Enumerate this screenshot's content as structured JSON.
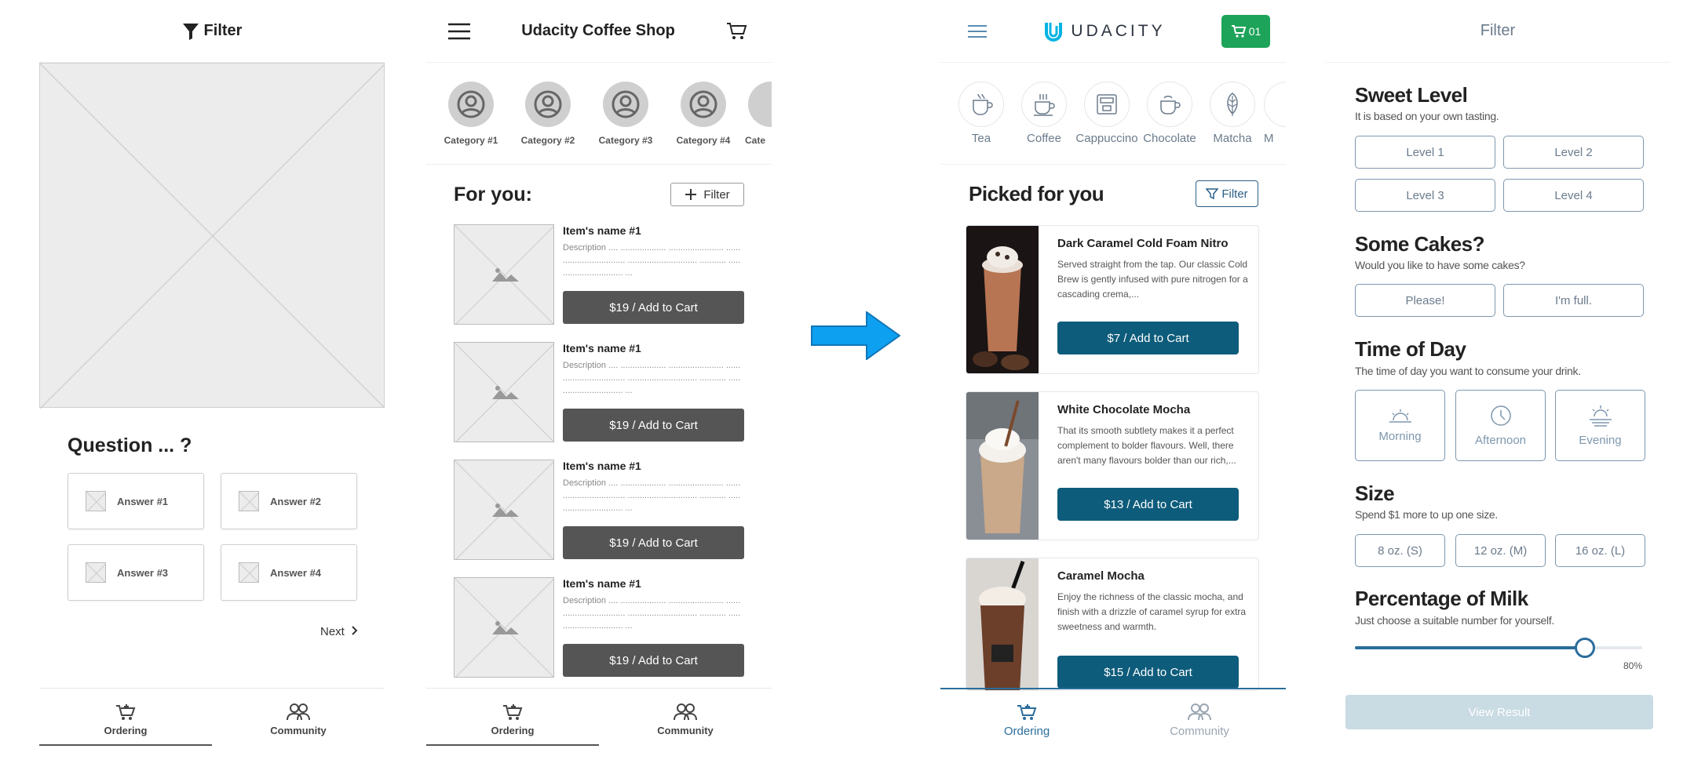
{
  "wireframe": {
    "header": {
      "title": "Filter"
    },
    "question": "Question ... ?",
    "answers": [
      "Answer #1",
      "Answer #2",
      "Answer #3",
      "Answer #4"
    ],
    "next_label": "Next",
    "nav": [
      {
        "label": "Ordering"
      },
      {
        "label": "Community"
      }
    ]
  },
  "wireframe_shop": {
    "header": {
      "title": "Udacity Coffee Shop"
    },
    "categories": [
      "Category #1",
      "Category #2",
      "Category #3",
      "Category #4",
      "Cate"
    ],
    "for_you": "For you:",
    "filter_label": "Filter",
    "items": [
      {
        "name": "Item's name #1",
        "desc": "Description .... ................... ....................... ...... .......................... ............................. ........... ..... ......................... ...",
        "cart": "$19 / Add to Cart"
      },
      {
        "name": "Item's name #1",
        "desc": "Description .... ................... ....................... ...... .......................... ............................. ........... ..... ......................... ...",
        "cart": "$19 / Add to Cart"
      },
      {
        "name": "Item's name #1",
        "desc": "Description .... ................... ....................... ...... .......................... ............................. ........... ..... ......................... ...",
        "cart": "$19 / Add to Cart"
      },
      {
        "name": "Item's name #1",
        "desc": "Description .... ................... ....................... ...... .......................... ............................. ........... ..... ......................... ...",
        "cart": "$19 / Add to Cart"
      }
    ],
    "nav": [
      {
        "label": "Ordering"
      },
      {
        "label": "Community"
      }
    ]
  },
  "app": {
    "logo": "UDACITY",
    "cart_count": "01",
    "categories": [
      "Tea",
      "Coffee",
      "Cappuccino",
      "Chocolate",
      "Matcha",
      "M"
    ],
    "picked": "Picked for you",
    "filter_label": "Filter",
    "products": [
      {
        "name": "Dark Caramel Cold Foam Nitro",
        "desc": "Served straight from the tap. Our classic Cold Brew is gently infused with pure nitrogen for a cascading crema,...",
        "cart": "$7 / Add to Cart"
      },
      {
        "name": "White Chocolate Mocha",
        "desc": "That its smooth subtlety makes it a perfect complement to bolder flavours. Well, there aren't many flavours bolder than our rich,...",
        "cart": "$13 / Add to Cart"
      },
      {
        "name": "Caramel Mocha",
        "desc": "Enjoy the richness of the classic mocha, and finish with a drizzle of caramel syrup for extra sweetness and warmth.",
        "cart": "$15 / Add to Cart"
      }
    ],
    "nav": [
      {
        "label": "Ordering"
      },
      {
        "label": "Community"
      }
    ],
    "accent": "#0e5c7b",
    "badge_color": "#1ea35a"
  },
  "filter": {
    "title": "Filter",
    "sweet": {
      "title": "Sweet Level",
      "desc": "It is based on your own tasting.",
      "options": [
        "Level 1",
        "Level 2",
        "Level 3",
        "Level 4"
      ]
    },
    "cakes": {
      "title": "Some Cakes?",
      "desc": "Would you like to have some cakes?",
      "options": [
        "Please!",
        "I'm full."
      ]
    },
    "time": {
      "title": "Time of Day",
      "desc": "The time of day you want to consume your drink.",
      "options": [
        "Morning",
        "Afternoon",
        "Evening"
      ]
    },
    "size": {
      "title": "Size",
      "desc": "Spend $1 more to up one size.",
      "options": [
        "8 oz. (S)",
        "12 oz. (M)",
        "16 oz. (L)"
      ]
    },
    "milk": {
      "title": "Percentage of Milk",
      "desc": "Just choose a suitable number for yourself.",
      "value_label": "80%",
      "value": 0.8
    },
    "view_result": "View Result"
  }
}
